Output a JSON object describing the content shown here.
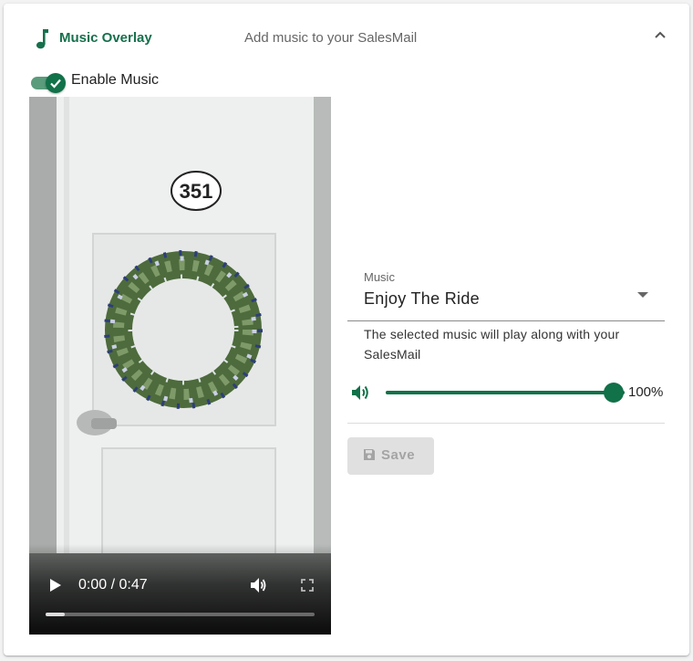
{
  "header": {
    "title": "Music Overlay",
    "subtitle": "Add music to your SalesMail",
    "icon": "music-note-icon",
    "collapse_icon": "chevron-up-icon"
  },
  "toggle": {
    "label": "Enable Music",
    "checked": true
  },
  "video": {
    "door_number": "351",
    "time_display": "0:00 / 0:47",
    "progress": 0.07,
    "controls": [
      "play-icon",
      "volume-icon",
      "fullscreen-icon"
    ]
  },
  "music_select": {
    "label": "Music",
    "value": "Enjoy The Ride"
  },
  "helper_text": "The selected music will play along with your SalesMail",
  "volume": {
    "value": 100,
    "display": "100%"
  },
  "save_button": {
    "label": "Save",
    "disabled": true
  },
  "colors": {
    "accent": "#117148",
    "title_green": "#16704c",
    "disabled_bg": "#e0e0e0",
    "disabled_text": "#a4a4a4"
  }
}
